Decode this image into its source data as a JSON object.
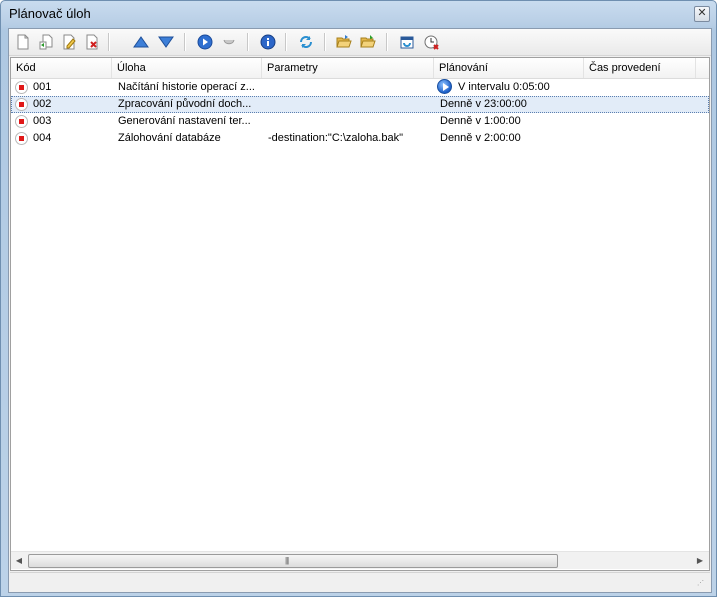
{
  "window": {
    "title": "Plánovač úloh",
    "close_glyph": "✕"
  },
  "toolbar": {
    "buttons": [
      {
        "name": "new-task-icon"
      },
      {
        "name": "copy-task-icon"
      },
      {
        "name": "edit-task-icon"
      },
      {
        "name": "delete-task-icon"
      },
      {
        "name": "move-up-icon"
      },
      {
        "name": "move-down-icon"
      },
      {
        "name": "run-task-icon"
      },
      {
        "name": "stop-task-icon"
      },
      {
        "name": "info-icon"
      },
      {
        "name": "refresh-icon"
      },
      {
        "name": "open-folder-icon"
      },
      {
        "name": "save-folder-icon"
      },
      {
        "name": "scheduler-settings-icon"
      },
      {
        "name": "clock-cancel-icon"
      }
    ]
  },
  "table": {
    "columns": [
      "Kód",
      "Úloha",
      "Parametry",
      "Plánování",
      "Čas provedení"
    ],
    "rows": [
      {
        "code": "001",
        "task": "Načítání historie operací z...",
        "params": "",
        "schedule": "V intervalu 0:05:00",
        "time": "",
        "status": "stopped",
        "schedule_icon": "play-icon",
        "selected": false
      },
      {
        "code": "002",
        "task": "Zpracování původní doch...",
        "params": "",
        "schedule": "Denně v 23:00:00",
        "time": "",
        "status": "stopped",
        "selected": true
      },
      {
        "code": "003",
        "task": "Generování nastavení ter...",
        "params": "",
        "schedule": "Denně v 1:00:00",
        "time": "",
        "status": "stopped",
        "selected": false
      },
      {
        "code": "004",
        "task": "Zálohování databáze",
        "params": "-destination:\"C:\\zaloha.bak\"",
        "schedule": "Denně v 2:00:00",
        "time": "",
        "status": "stopped",
        "selected": false
      }
    ]
  },
  "scrollbar": {
    "left_glyph": "◀",
    "right_glyph": "▶",
    "grip": "|||"
  },
  "colors": {
    "title_bg": "#b9cfe6",
    "selection": "#e2ecf8",
    "stop_red": "#e01818",
    "run_blue": "#1b5fc9"
  }
}
